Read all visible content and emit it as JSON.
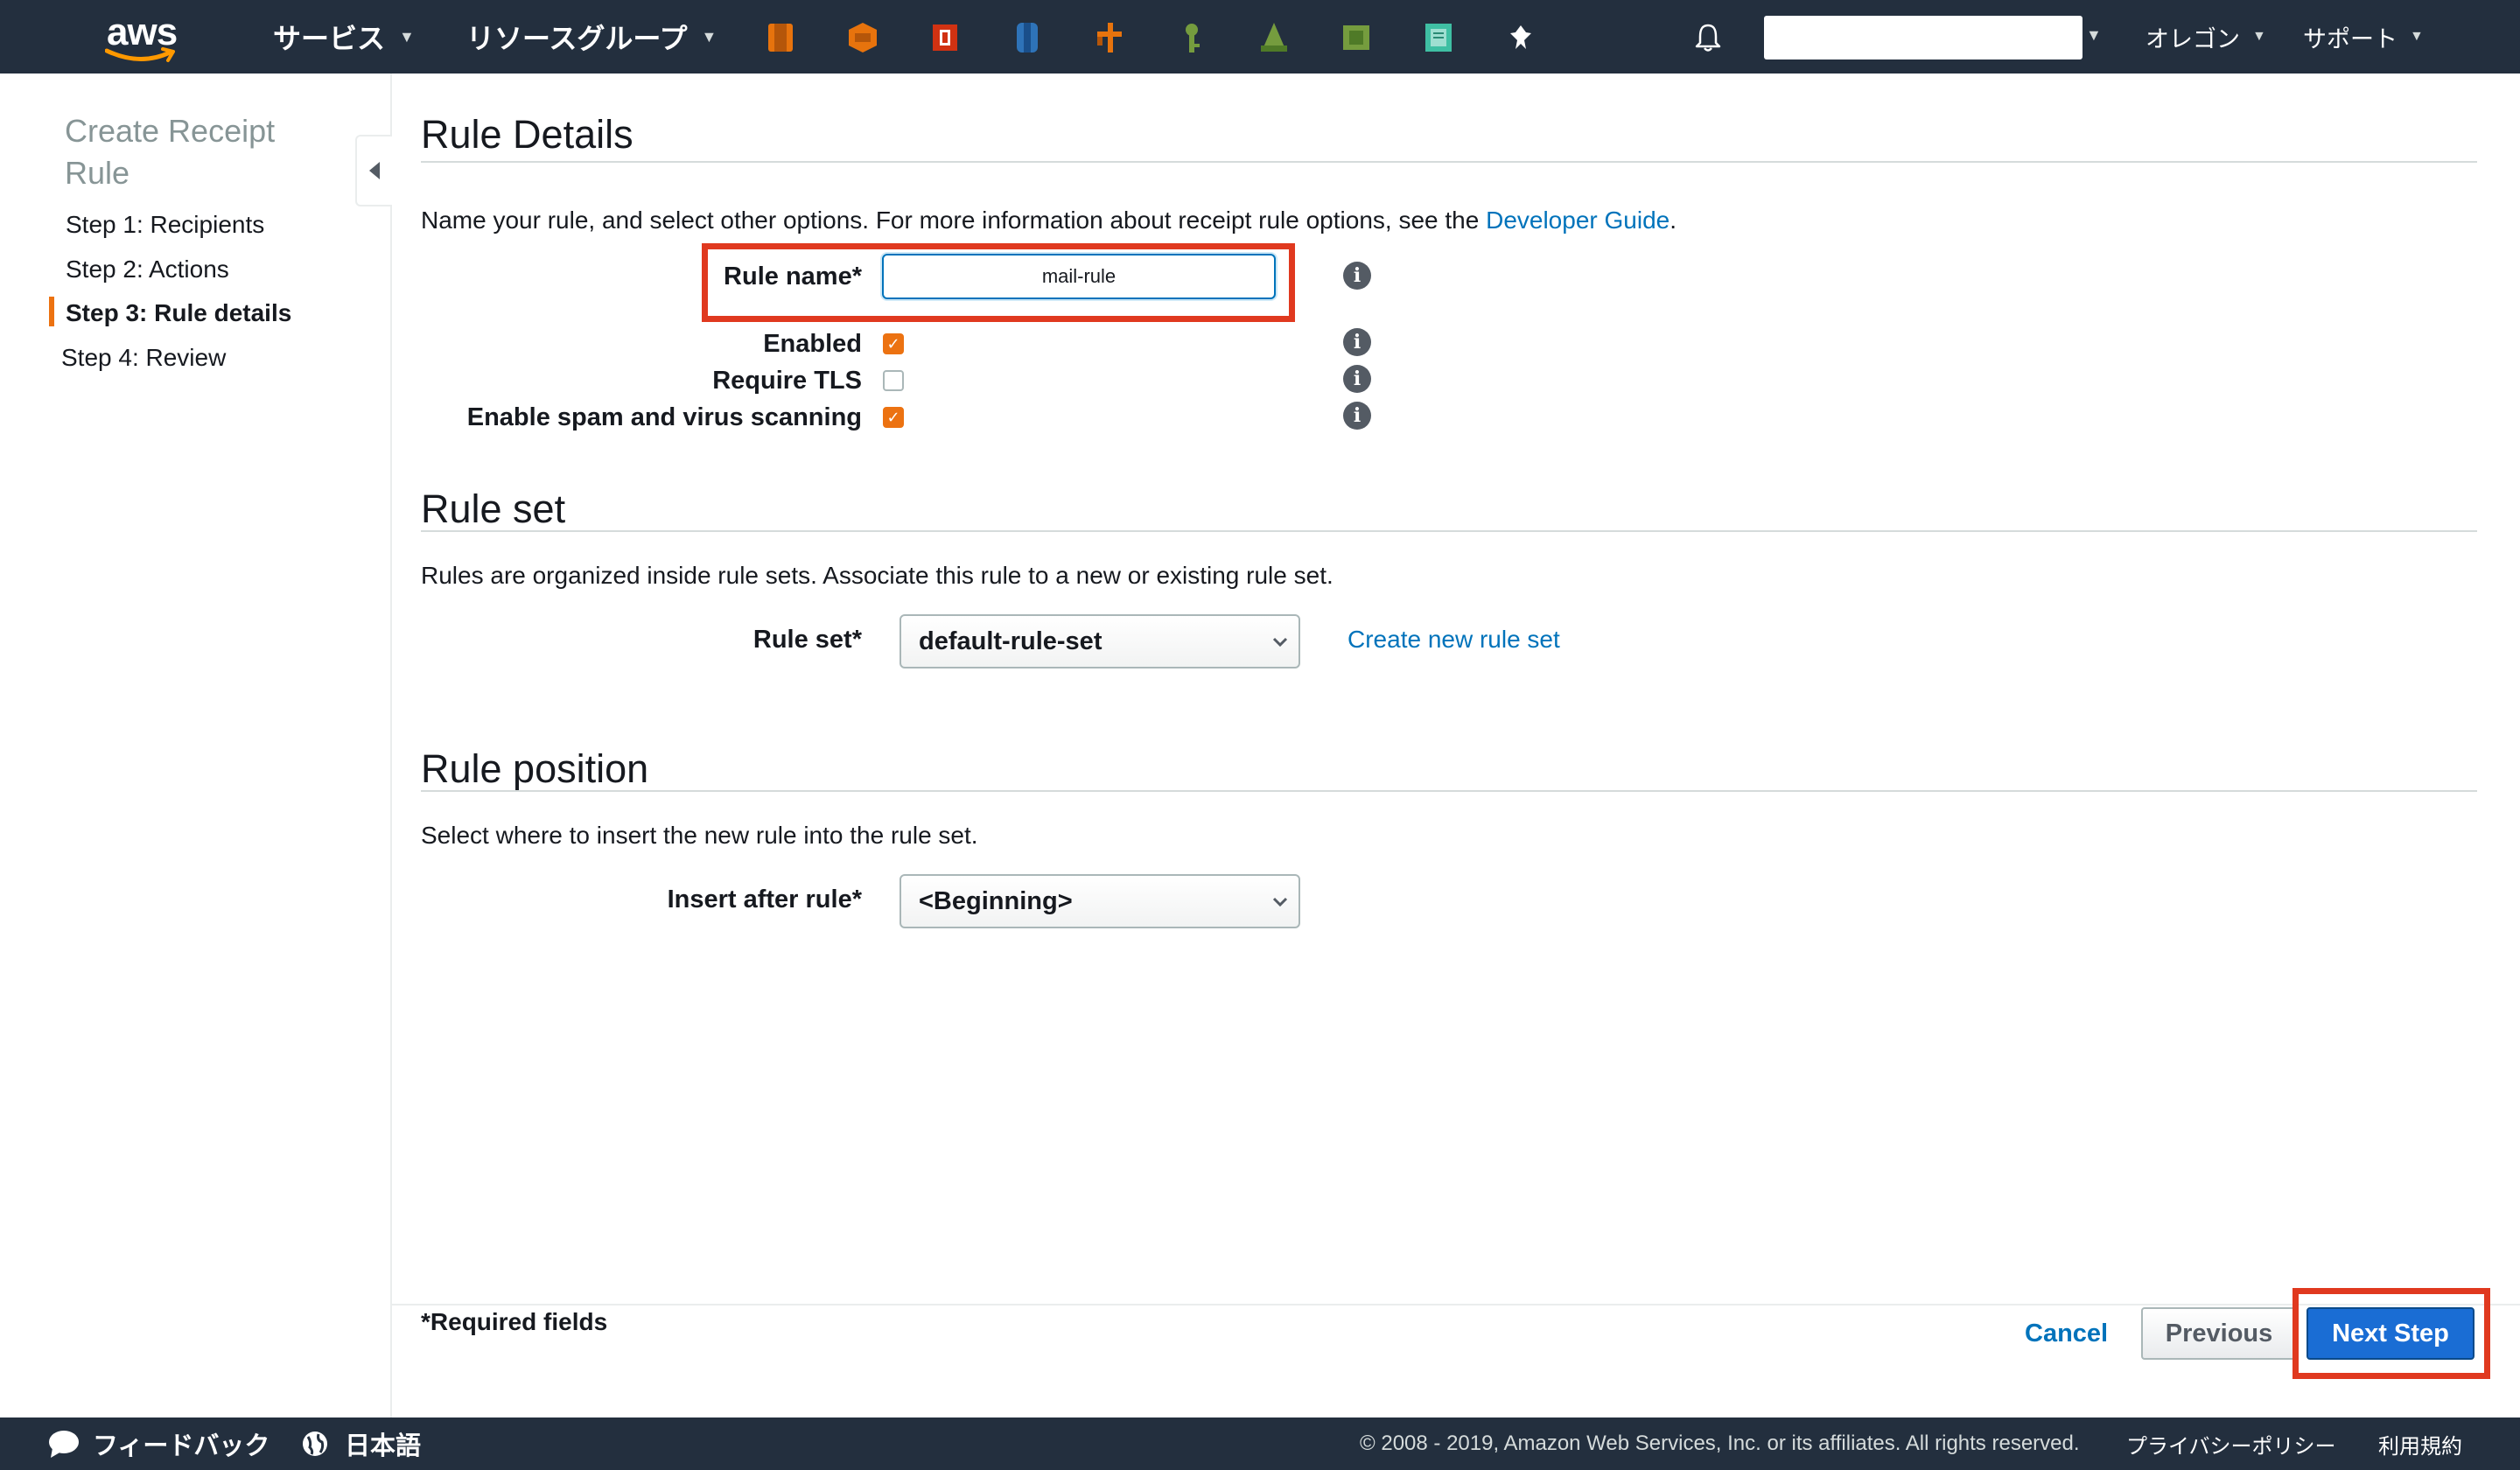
{
  "topnav": {
    "logo_text": "aws",
    "services_label": "サービス",
    "resource_groups_label": "リソースグループ",
    "shortcut_icons": [
      {
        "name": "ec2-icon",
        "color": "#e7730d"
      },
      {
        "name": "s3-icon",
        "color": "#e7730d"
      },
      {
        "name": "ses-icon",
        "color": "#d13212"
      },
      {
        "name": "dynamodb-icon",
        "color": "#2e73b8"
      },
      {
        "name": "lambda-icon",
        "color": "#e7730d"
      },
      {
        "name": "iam-icon",
        "color": "#759c3e"
      },
      {
        "name": "cloudformation-icon",
        "color": "#759c3e"
      },
      {
        "name": "cloudwatch-icon",
        "color": "#759c3e"
      },
      {
        "name": "workdocs-icon",
        "color": "#3fbfa3"
      },
      {
        "name": "pin-icon",
        "color": "#ffffff"
      }
    ],
    "account_value": "",
    "region_label": "オレゴン",
    "support_label": "サポート"
  },
  "sidebar": {
    "title": "Create Receipt Rule",
    "steps": [
      {
        "label": "Step 1: Recipients"
      },
      {
        "label": "Step 2: Actions"
      },
      {
        "label": "Step 3: Rule details"
      },
      {
        "label": "Step 4: Review"
      }
    ]
  },
  "rule_details": {
    "title": "Rule Details",
    "description": "Name your rule, and select other options. For more information about receipt rule options, see the",
    "guide_link": "Developer Guide",
    "period": ".",
    "rule_name_label": "Rule name*",
    "rule_name_value": "mail-rule",
    "enabled_label": "Enabled",
    "enabled": true,
    "require_tls_label": "Require TLS",
    "require_tls": false,
    "spam_label": "Enable spam and virus scanning",
    "spam": true
  },
  "rule_set": {
    "title": "Rule set",
    "description": "Rules are organized inside rule sets. Associate this rule to a new or existing rule set.",
    "label": "Rule set*",
    "selected": "default-rule-set",
    "create_link": "Create new rule set"
  },
  "rule_position": {
    "title": "Rule position",
    "description": "Select where to insert the new rule into the rule set.",
    "label": "Insert after rule*",
    "selected": "<Beginning>"
  },
  "footer_actions": {
    "required_note": "*Required fields",
    "cancel_label": "Cancel",
    "previous_label": "Previous",
    "next_label": "Next Step"
  },
  "bottombar": {
    "feedback_label": "フィードバック",
    "language_label": "日本語",
    "copyright": "© 2008 - 2019, Amazon Web Services, Inc. or its affiliates. All rights reserved.",
    "privacy_label": "プライバシーポリシー",
    "terms_label": "利用規約"
  },
  "colors": {
    "nav_bg": "#232f3e",
    "accent_orange": "#ec7211",
    "link_blue": "#0073bb",
    "primary_button": "#1a6dd4",
    "highlight_red": "#e0391f"
  }
}
